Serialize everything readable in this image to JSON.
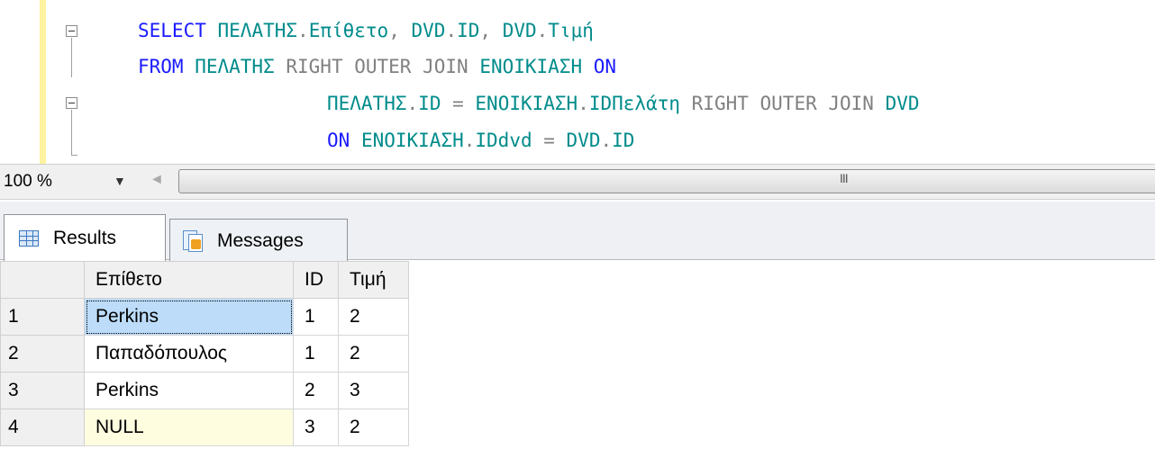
{
  "editor": {
    "lines": [
      {
        "tokens": [
          {
            "t": "SELECT ",
            "c": "kw"
          },
          {
            "t": "ΠΕΛΑΤΗΣ",
            "c": "id"
          },
          {
            "t": ".",
            "c": "op"
          },
          {
            "t": "Επίθετο",
            "c": "id"
          },
          {
            "t": ", ",
            "c": "op"
          },
          {
            "t": "DVD",
            "c": "id"
          },
          {
            "t": ".",
            "c": "op"
          },
          {
            "t": "ID",
            "c": "id"
          },
          {
            "t": ", ",
            "c": "op"
          },
          {
            "t": "DVD",
            "c": "id"
          },
          {
            "t": ".",
            "c": "op"
          },
          {
            "t": "Τιμή",
            "c": "id"
          }
        ]
      },
      {
        "tokens": [
          {
            "t": "FROM ",
            "c": "kw"
          },
          {
            "t": "ΠΕΛΑΤΗΣ ",
            "c": "id"
          },
          {
            "t": "RIGHT OUTER JOIN ",
            "c": "op"
          },
          {
            "t": "ΕΝΟΙΚΙΑΣΗ ",
            "c": "id"
          },
          {
            "t": "ON",
            "c": "kw"
          }
        ]
      },
      {
        "tokens": [
          {
            "t": "ΠΕΛΑΤΗΣ",
            "c": "id"
          },
          {
            "t": ".",
            "c": "op"
          },
          {
            "t": "ID",
            "c": "id"
          },
          {
            "t": " = ",
            "c": "op"
          },
          {
            "t": "ΕΝΟΙΚΙΑΣΗ",
            "c": "id"
          },
          {
            "t": ".",
            "c": "op"
          },
          {
            "t": "IDΠελάτη",
            "c": "id"
          },
          {
            "t": " RIGHT OUTER JOIN ",
            "c": "op"
          },
          {
            "t": "DVD",
            "c": "id"
          }
        ]
      },
      {
        "tokens": [
          {
            "t": "ON ",
            "c": "kw"
          },
          {
            "t": "ΕΝΟΙΚΙΑΣΗ",
            "c": "id"
          },
          {
            "t": ".",
            "c": "op"
          },
          {
            "t": "IDdvd",
            "c": "id"
          },
          {
            "t": " = ",
            "c": "op"
          },
          {
            "t": "DVD",
            "c": "id"
          },
          {
            "t": ".",
            "c": "op"
          },
          {
            "t": "ID",
            "c": "id"
          }
        ]
      }
    ]
  },
  "zoombar": {
    "zoom": "100 %",
    "dropdown_glyph": "▼",
    "scroll_left_glyph": "◄",
    "grip_glyph": "III"
  },
  "tabs": {
    "results": "Results",
    "messages": "Messages"
  },
  "results": {
    "columns": [
      "Επίθετο",
      "ID",
      "Τιμή"
    ],
    "rows": [
      {
        "num": "1",
        "cells": [
          "Perkins",
          "1",
          "2"
        ]
      },
      {
        "num": "2",
        "cells": [
          "Παπαδόπουλος",
          "1",
          "2"
        ]
      },
      {
        "num": "3",
        "cells": [
          "Perkins",
          "2",
          "3"
        ]
      },
      {
        "num": "4",
        "cells": [
          "NULL",
          "3",
          "2"
        ]
      }
    ]
  }
}
